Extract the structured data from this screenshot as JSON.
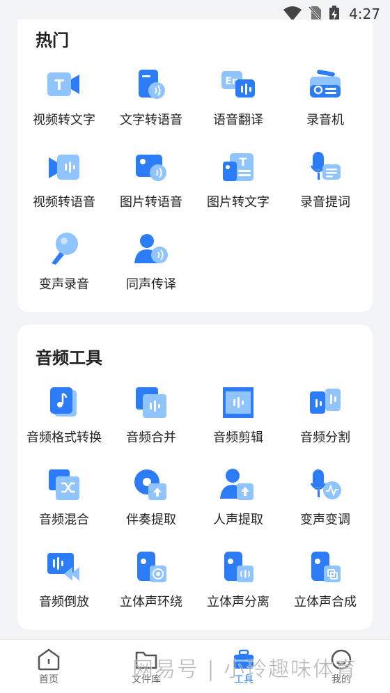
{
  "status": {
    "time": "4:27"
  },
  "hot": {
    "title": "热门",
    "items": [
      {
        "label": "视频转文字",
        "icon": "video-to-text-icon"
      },
      {
        "label": "文字转语音",
        "icon": "text-to-speech-icon"
      },
      {
        "label": "语音翻译",
        "icon": "voice-translate-icon"
      },
      {
        "label": "录音机",
        "icon": "recorder-icon"
      },
      {
        "label": "视频转语音",
        "icon": "video-to-audio-icon"
      },
      {
        "label": "图片转语音",
        "icon": "image-to-speech-icon"
      },
      {
        "label": "图片转文字",
        "icon": "image-to-text-icon"
      },
      {
        "label": "录音提词",
        "icon": "teleprompter-icon"
      },
      {
        "label": "变声录音",
        "icon": "voice-change-record-icon"
      },
      {
        "label": "同声传译",
        "icon": "simultaneous-interpretation-icon"
      }
    ]
  },
  "audio": {
    "title": "音频工具",
    "items": [
      {
        "label": "音频格式转换",
        "icon": "audio-format-convert-icon"
      },
      {
        "label": "音频合并",
        "icon": "audio-merge-icon"
      },
      {
        "label": "音频剪辑",
        "icon": "audio-cut-icon"
      },
      {
        "label": "音频分割",
        "icon": "audio-split-icon"
      },
      {
        "label": "音频混合",
        "icon": "audio-mix-icon"
      },
      {
        "label": "伴奏提取",
        "icon": "accompaniment-extract-icon"
      },
      {
        "label": "人声提取",
        "icon": "vocal-extract-icon"
      },
      {
        "label": "变声变调",
        "icon": "voice-pitch-icon"
      },
      {
        "label": "音频倒放",
        "icon": "audio-reverse-icon"
      },
      {
        "label": "立体声环绕",
        "icon": "stereo-surround-icon"
      },
      {
        "label": "立体声分离",
        "icon": "stereo-separate-icon"
      },
      {
        "label": "立体声合成",
        "icon": "stereo-compose-icon"
      }
    ]
  },
  "tabs": [
    {
      "label": "首页",
      "icon": "home-icon"
    },
    {
      "label": "文件库",
      "icon": "folder-icon"
    },
    {
      "label": "工具",
      "icon": "toolbox-icon"
    },
    {
      "label": "我的",
      "icon": "profile-icon"
    }
  ],
  "watermark": "网易号 | 小玲趣味体育",
  "colors": {
    "accent": "#2b7cf6",
    "icon_light": "#8fc4ff"
  }
}
